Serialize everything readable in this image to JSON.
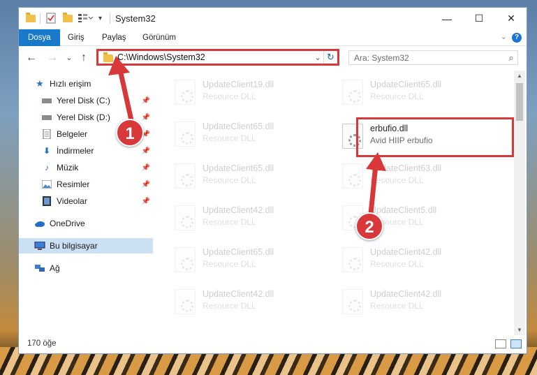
{
  "window": {
    "title": "System32",
    "minimize": "—",
    "maximize": "☐",
    "close": "✕"
  },
  "ribbon": {
    "tabs": [
      "Dosya",
      "Giriş",
      "Paylaş",
      "Görünüm"
    ],
    "expand_chevron": "⌄",
    "help": "?"
  },
  "nav": {
    "back": "←",
    "forward": "→",
    "recent": "⌄",
    "up": "↑",
    "address": "C:\\Windows\\System32",
    "address_chevron": "⌄",
    "refresh": "↻",
    "search_placeholder": "Ara: System32",
    "search_icon": "⌕"
  },
  "sidebar": {
    "items": [
      {
        "label": "Hızlı erişim",
        "icon": "star-icon"
      },
      {
        "label": "Yerel Disk (C:)",
        "icon": "drive-icon"
      },
      {
        "label": "Yerel Disk (D:)",
        "icon": "drive-icon"
      },
      {
        "label": "Belgeler",
        "icon": "documents-icon"
      },
      {
        "label": "İndirmeler",
        "icon": "download-icon"
      },
      {
        "label": "Müzik",
        "icon": "music-icon"
      },
      {
        "label": "Resimler",
        "icon": "pictures-icon"
      },
      {
        "label": "Videolar",
        "icon": "video-icon"
      },
      {
        "label": "OneDrive",
        "icon": "cloud-icon"
      },
      {
        "label": "Bu bilgisayar",
        "icon": "computer-icon"
      },
      {
        "label": "Ağ",
        "icon": "network-icon"
      }
    ],
    "selected": "Bu bilgisayar"
  },
  "files": {
    "left": [
      {
        "name": "UpdateClient19.dll",
        "desc": "Resource DLL"
      },
      {
        "name": "UpdateClient65.dll",
        "desc": "Resource DLL"
      },
      {
        "name": "UpdateClient65.dll",
        "desc": "Resource DLL"
      },
      {
        "name": "UpdateClient42.dll",
        "desc": "Resource DLL"
      },
      {
        "name": "UpdateClient65.dll",
        "desc": "Resource DLL"
      },
      {
        "name": "UpdateClient42.dll",
        "desc": "Resource DLL"
      }
    ],
    "right": [
      {
        "name": "UpdateClient65.dll",
        "desc": "Resource DLL"
      },
      {
        "name": "erbufio.dll",
        "desc": "Avid HIIP erbufio"
      },
      {
        "name": "UpdateClient63.dll",
        "desc": "Resource DLL"
      },
      {
        "name": "UpdateClient5.dll",
        "desc": "Resource DLL"
      },
      {
        "name": "UpdateClient42.dll",
        "desc": "Resource DLL"
      },
      {
        "name": "UpdateClient42.dll",
        "desc": "Resource DLL"
      }
    ]
  },
  "status": {
    "count": "170 öğe"
  },
  "annotations": {
    "badge1": "1",
    "badge2": "2",
    "color": "#d9383a"
  }
}
